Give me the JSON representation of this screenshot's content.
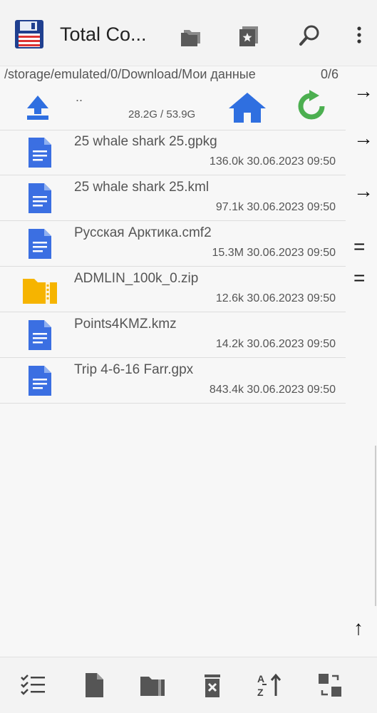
{
  "app": {
    "title": "Total Co..."
  },
  "path": {
    "text": "/storage/emulated/0/Download/Мои данные",
    "count": "0/6"
  },
  "updir": {
    "label": "..",
    "size": "28.2G / 53.9G"
  },
  "files": [
    {
      "name": "25 whale shark 25.gpkg",
      "size": "136.0k",
      "date": "30.06.2023",
      "time": "09:50",
      "icon": "document-icon"
    },
    {
      "name": "25 whale shark 25.kml",
      "size": "97.1k",
      "date": "30.06.2023",
      "time": "09:50",
      "icon": "document-icon"
    },
    {
      "name": "Русская Арктика.cmf2",
      "size": "15.3M",
      "date": "30.06.2023",
      "time": "09:50",
      "icon": "document-icon"
    },
    {
      "name": "ADMLIN_100k_0.zip",
      "size": "12.6k",
      "date": "30.06.2023",
      "time": "09:50",
      "icon": "zip-folder-icon"
    },
    {
      "name": "Points4KMZ.kmz",
      "size": "14.2k",
      "date": "30.06.2023",
      "time": "09:50",
      "icon": "document-icon"
    },
    {
      "name": "Trip 4-6-16 Farr.gpx",
      "size": "843.4k",
      "date": "30.06.2023",
      "time": "09:50",
      "icon": "document-icon"
    }
  ],
  "right_strip": {
    "arrow1": "→",
    "arrow2": "→",
    "arrow3": "→",
    "equals1": "=",
    "equals2": "=",
    "up_arrow": "↑"
  },
  "colors": {
    "accent_blue": "#2f6fe0",
    "refresh_green": "#4caf50",
    "folder_yellow": "#f6b400",
    "doc_blue": "#3b6fe2"
  }
}
